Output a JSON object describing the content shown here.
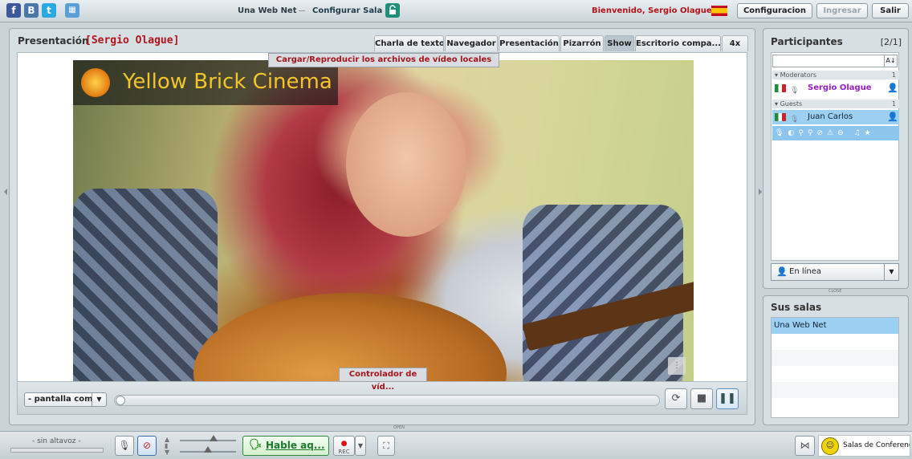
{
  "topbar": {
    "social": [
      "f",
      "B",
      "t"
    ],
    "room_name": "Una Web Net",
    "configure_room": "Configurar Sala",
    "welcome": "Bienvenido, Sergio Olague",
    "config_button": "Configuracion",
    "enter_button": "Ingresar",
    "exit_button": "Salir"
  },
  "presentation": {
    "title": "Presentación",
    "presenter": "[Sergio Olague]",
    "tabs": [
      "Charla de texto",
      "Navegador",
      "Presentación",
      "Pizarrón",
      "Show",
      "Escritorio compa...",
      "4x"
    ],
    "active_tab": "Show",
    "load_tooltip": "Cargar/Reproducir los archivos de vídeo locales",
    "video_logo_text": "Yellow Brick Cinema",
    "controller_tooltip": "Controlador de víd...",
    "screen_mode": "- pantalla com",
    "seek_progress": 0
  },
  "participants": {
    "title": "Participantes",
    "count": "[2/1]",
    "groups": [
      {
        "label": "Moderators",
        "count": "1",
        "users": [
          "Sergio Olague"
        ]
      },
      {
        "label": "Guests",
        "count": "1",
        "users": [
          "Juan Carlos"
        ]
      }
    ],
    "status": "En línea"
  },
  "rooms": {
    "title": "Sus salas",
    "items": [
      "Una Web Net"
    ]
  },
  "bottombar": {
    "speaker_status": "- sin altavoz -",
    "speak_button": "Hable aq...",
    "rec_label": "REC",
    "brand": "Salas de Conferencias.com",
    "handle_open": "OPEN",
    "handle_close": "CLOSE"
  },
  "colors": {
    "presenter_red": "#b3141a",
    "moderator_name": "#9b1bc7",
    "selection_blue": "#9cd0f2"
  }
}
